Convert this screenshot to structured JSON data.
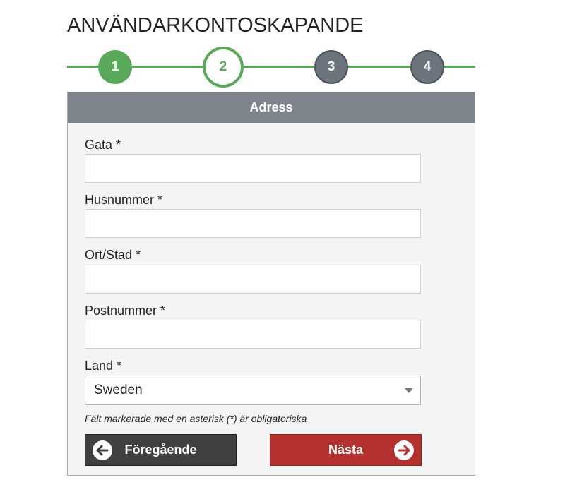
{
  "page": {
    "title": "ANVÄNDARKONTOSKAPANDE"
  },
  "stepper": {
    "steps": [
      "1",
      "2",
      "3",
      "4"
    ],
    "current": 2
  },
  "panel": {
    "header": "Adress"
  },
  "form": {
    "street_label": "Gata *",
    "street_value": "",
    "house_number_label": "Husnummer *",
    "house_number_value": "",
    "city_label": "Ort/Stad *",
    "city_value": "",
    "postal_code_label": "Postnummer *",
    "postal_code_value": "",
    "country_label": "Land *",
    "country_value": "Sweden",
    "required_note": "Fält markerade med en asterisk (*) är obligatoriska"
  },
  "buttons": {
    "prev_label": "Föregående",
    "next_label": "Nästa"
  },
  "colors": {
    "green": "#5aa85a",
    "gray_step": "#6c737c",
    "header": "#7d848b",
    "next": "#b3312e",
    "prev": "#404040"
  }
}
